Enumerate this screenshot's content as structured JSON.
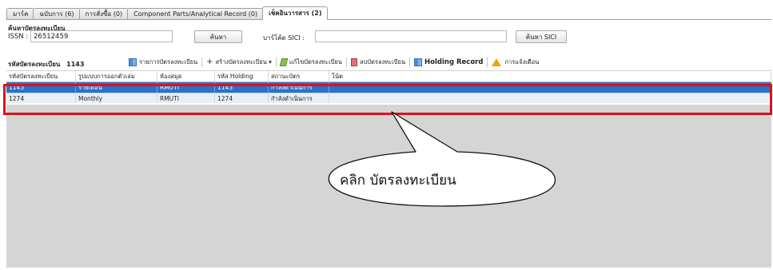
{
  "tabs": [
    {
      "label": "มาร์ค"
    },
    {
      "label": "ฉบับการ (6)"
    },
    {
      "label": "การสั่งซื้อ (0)"
    },
    {
      "label": "Component Parts/Analytical Record (0)"
    },
    {
      "label": "เช็คอินวารสาร (2)"
    }
  ],
  "search": {
    "section_label": "ค้นหาบัตรลงทะเบียน",
    "issn_label": "ISSN :",
    "issn_value": "26512459",
    "search_button": "ค้นหา",
    "sici_label": "บาร์โค้ด SICI :",
    "sici_value": "",
    "sici_button": "ค้นหา SICI"
  },
  "toolbar": {
    "reg_label": "รหัสบัตรลงทะเบียน",
    "reg_value": "1143",
    "items": [
      "รายการบัตรลงทะเบียน",
      "สร้างบัตรลงทะเบียน ▾",
      "แก้ไขบัตรลงทะเบียน",
      "ลบบัตรลงทะเบียน",
      "Holding Record",
      "การแจ้งเตือน"
    ]
  },
  "table": {
    "headers": [
      "รหัสบัตรลงทะเบียน",
      "รูปแบบการออกตัวเล่ม",
      "ห้องสมุด",
      "รหัส Holding",
      "สถานะบัตร",
      "โน้ต"
    ],
    "rows": [
      [
        "1143",
        "รายเดือน",
        "RMUTI",
        "1143",
        "กำลังดำเนินการ",
        ""
      ],
      [
        "1274",
        "Monthly",
        "RMUTI",
        "1274",
        "กำลังดำเนินการ",
        ""
      ]
    ]
  },
  "callout": {
    "text": "คลิก บัตรลงทะเบียน"
  },
  "colors": {
    "selected_row": "#2a72c9",
    "highlight": "#e0101a"
  }
}
